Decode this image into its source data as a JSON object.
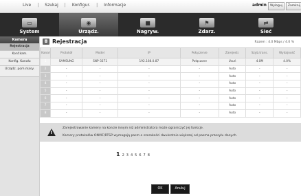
{
  "topbar": {
    "menu": [
      "Live",
      "Szukaj",
      "Konfigur.",
      "Informacje"
    ],
    "user": "admin",
    "logout_label": "Wyloguj",
    "shutdown_label": "Zamknij"
  },
  "nav": {
    "tabs": [
      {
        "label": "System",
        "icon": "system-icon"
      },
      {
        "label": "Urządz.",
        "icon": "device-icon"
      },
      {
        "label": "Nagryw.",
        "icon": "record-icon"
      },
      {
        "label": "Zdarz.",
        "icon": "event-icon"
      },
      {
        "label": "Sieć",
        "icon": "network-icon"
      }
    ],
    "active": "Urządz."
  },
  "sidebar": {
    "header": "Kamera",
    "items": [
      "Rejestracja",
      "Konf.kam.",
      "Konfig. Kanału",
      "Urządz. pom.masy."
    ]
  },
  "main": {
    "title": "Rejestracja",
    "total": "Razem : 4.0 Mbps / 4.0 %",
    "columns": [
      "Kanał",
      "Protokół",
      "Model",
      "IP",
      "Połączenie",
      "Zarejestr.",
      "Szyb.trans.",
      "Wydajność"
    ],
    "rows": [
      [
        "1",
        "SAMSUNG",
        "SNP-3371",
        "192.168.0.87",
        "Połączone",
        "Usuń",
        "4.0M",
        "4.0%"
      ],
      [
        "2",
        "-",
        "-",
        "-",
        "-",
        "Auto",
        "-",
        "-"
      ],
      [
        "3",
        "-",
        "-",
        "-",
        "-",
        "Auto",
        "-",
        "-"
      ],
      [
        "4",
        "-",
        "-",
        "-",
        "-",
        "Auto",
        "-",
        "-"
      ],
      [
        "5",
        "-",
        "-",
        "-",
        "-",
        "Auto",
        "-",
        "-"
      ],
      [
        "6",
        "-",
        "-",
        "-",
        "-",
        "Auto",
        "-",
        "-"
      ],
      [
        "7",
        "-",
        "-",
        "-",
        "-",
        "Auto",
        "-",
        "-"
      ],
      [
        "8",
        "-",
        "-",
        "-",
        "-",
        "Auto",
        "-",
        "-"
      ]
    ],
    "warning_lines": [
      "Zarejestrowanie kamery na koncie innym niż administratora może ograniczyć jej funkcje.",
      "Kamery protokołów ONVIF/RTSP wymagają pasm o szerokości dwukrotnie większej od pasma przesyłu danych."
    ],
    "pages": [
      "1",
      "2",
      "3",
      "4",
      "5",
      "6",
      "7",
      "8"
    ],
    "current_page": "1",
    "ok_label": "OK",
    "cancel_label": "Anuluj"
  }
}
